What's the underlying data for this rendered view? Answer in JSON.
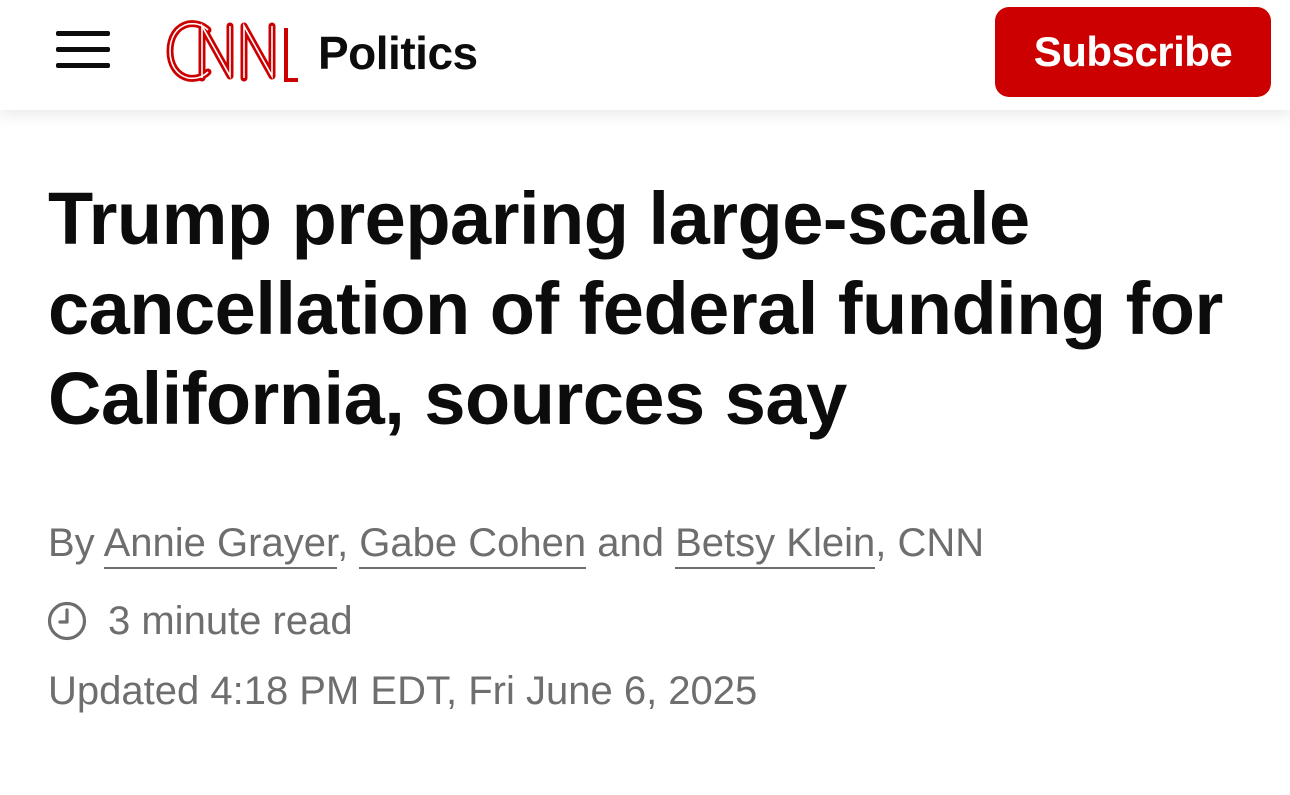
{
  "header": {
    "logo_icon": "cnn-logo",
    "section": "Politics",
    "subscribe_label": "Subscribe",
    "menu_icon": "hamburger-menu-icon"
  },
  "article": {
    "headline": "Trump preparing large-scale cancellation of federal funding for California, sources say",
    "byline": {
      "prefix": "By ",
      "authors": [
        "Annie Grayer",
        "Gabe Cohen",
        "Betsy Klein"
      ],
      "sep1": ", ",
      "sep2": " and ",
      "suffix": ", CNN"
    },
    "read_time": "3 minute read",
    "read_time_icon": "clock-icon",
    "updated": "Updated 4:18 PM EDT, Fri June 6, 2025"
  },
  "colors": {
    "brand_red": "#cc0000",
    "text_dark": "#0c0c0c",
    "text_gray": "#6e6e6e"
  }
}
